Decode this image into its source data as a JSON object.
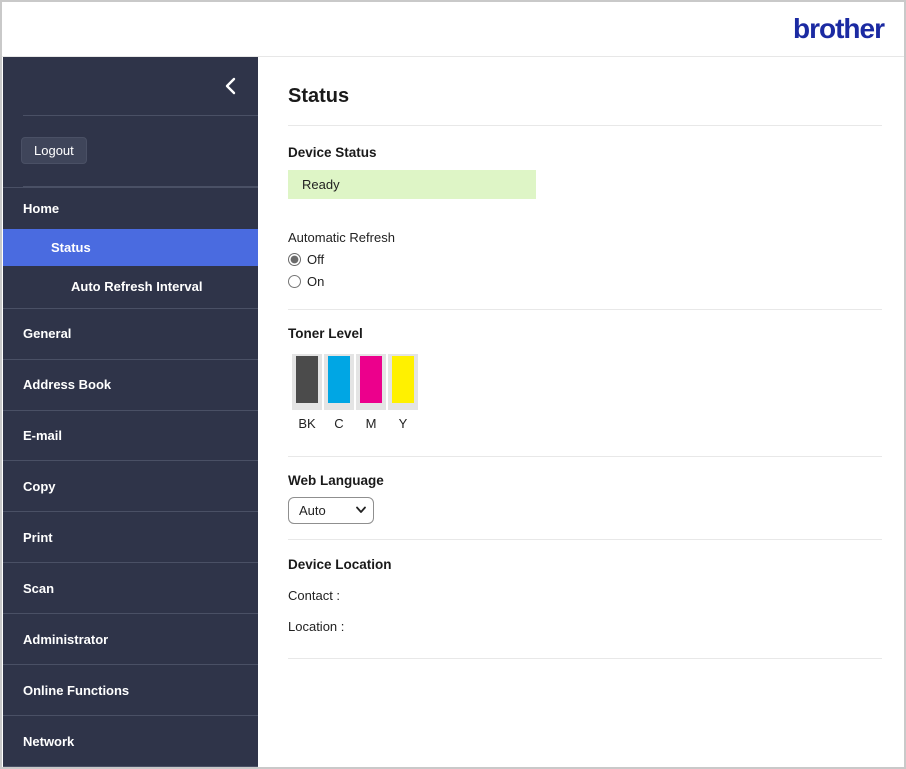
{
  "header": {
    "logo_text": "brother"
  },
  "sidebar": {
    "logout_label": "Logout",
    "items": [
      {
        "label": "Home",
        "level": 1,
        "active": false
      },
      {
        "label": "Status",
        "level": 2,
        "active": true
      },
      {
        "label": "Auto Refresh Interval",
        "level": 3,
        "active": false
      },
      {
        "label": "General",
        "level": 1,
        "active": false
      },
      {
        "label": "Address Book",
        "level": 1,
        "active": false
      },
      {
        "label": "E-mail",
        "level": 1,
        "active": false
      },
      {
        "label": "Copy",
        "level": 1,
        "active": false
      },
      {
        "label": "Print",
        "level": 1,
        "active": false
      },
      {
        "label": "Scan",
        "level": 1,
        "active": false
      },
      {
        "label": "Administrator",
        "level": 1,
        "active": false
      },
      {
        "label": "Online Functions",
        "level": 1,
        "active": false
      },
      {
        "label": "Network",
        "level": 1,
        "active": false
      }
    ]
  },
  "main": {
    "title": "Status",
    "device_status": {
      "heading": "Device Status",
      "value": "Ready",
      "value_bg": "#def5c6"
    },
    "auto_refresh": {
      "label": "Automatic Refresh",
      "options": [
        {
          "label": "Off",
          "selected": true
        },
        {
          "label": "On",
          "selected": false
        }
      ]
    },
    "toner": {
      "heading": "Toner Level",
      "cartridges": [
        {
          "label": "BK",
          "color": "#4b4b4b"
        },
        {
          "label": "C",
          "color": "#00a6e4"
        },
        {
          "label": "M",
          "color": "#ec008c"
        },
        {
          "label": "Y",
          "color": "#fff100"
        }
      ]
    },
    "web_language": {
      "heading": "Web Language",
      "selected": "Auto"
    },
    "device_location": {
      "heading": "Device Location",
      "contact_label": "Contact :",
      "location_label": "Location :"
    }
  },
  "colors": {
    "sidebar_bg": "#2f3449",
    "active_item_bg": "#4a6be0",
    "logo_blue": "#1b2aa2",
    "ready_green": "#def5c6"
  }
}
